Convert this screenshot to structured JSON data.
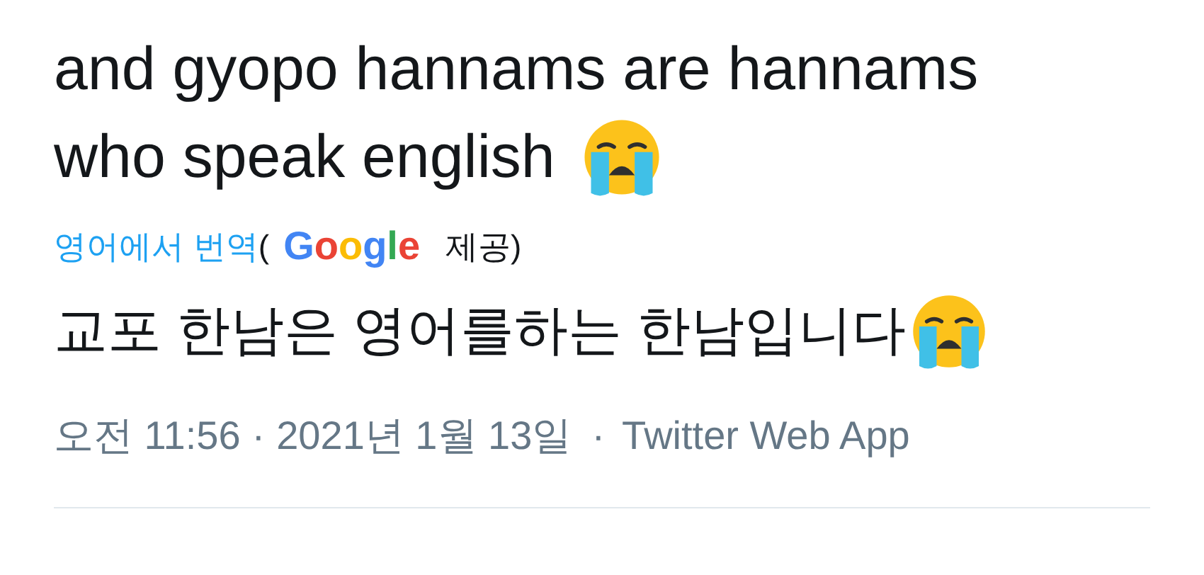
{
  "tweet": {
    "text_lines": [
      "and gyopo hannams are hannams",
      "who speak english"
    ],
    "translation": {
      "link": "영어에서 번역",
      "open": "(",
      "provider": "Google",
      "close": "제공)"
    },
    "translated_text": "교포 한남은 영어를하는 한남입니다",
    "meta": {
      "time": "오전 11:56",
      "separator_1": "·",
      "date": "2021년 1월 13일",
      "separator_2": "·",
      "source": "Twitter Web App"
    }
  }
}
